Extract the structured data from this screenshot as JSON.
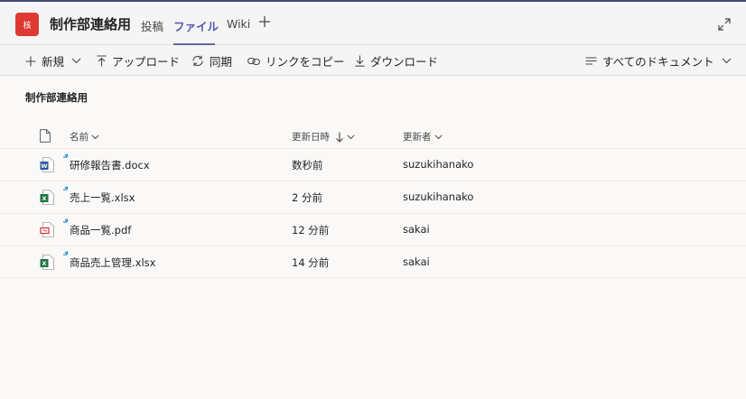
{
  "header": {
    "avatar_text": "核",
    "team_name": "制作部連絡用",
    "tabs": [
      {
        "label": "投稿"
      },
      {
        "label": "ファイル"
      },
      {
        "label": "Wiki"
      }
    ]
  },
  "toolbar": {
    "new_label": "新規",
    "upload_label": "アップロード",
    "sync_label": "同期",
    "copy_link_label": "リンクをコピー",
    "download_label": "ダウンロード",
    "view_label": "すべてのドキュメント"
  },
  "breadcrumb": "制作部連絡用",
  "columns": {
    "name": "名前",
    "modified": "更新日時",
    "modified_by": "更新者"
  },
  "files": [
    {
      "name": "研修報告書.docx",
      "modified": "数秒前",
      "modified_by": "suzukihanako",
      "type": "word"
    },
    {
      "name": "売上一覧.xlsx",
      "modified": "2 分前",
      "modified_by": "suzukihanako",
      "type": "excel"
    },
    {
      "name": "商品一覧.pdf",
      "modified": "12 分前",
      "modified_by": "sakai",
      "type": "pdf"
    },
    {
      "name": "商品売上管理.xlsx",
      "modified": "14 分前",
      "modified_by": "sakai",
      "type": "excel"
    }
  ],
  "colors": {
    "accent": "#6264a7",
    "avatar": "#dc3a33",
    "word": "#2b579a",
    "excel": "#217346",
    "pdf": "#d13438"
  }
}
